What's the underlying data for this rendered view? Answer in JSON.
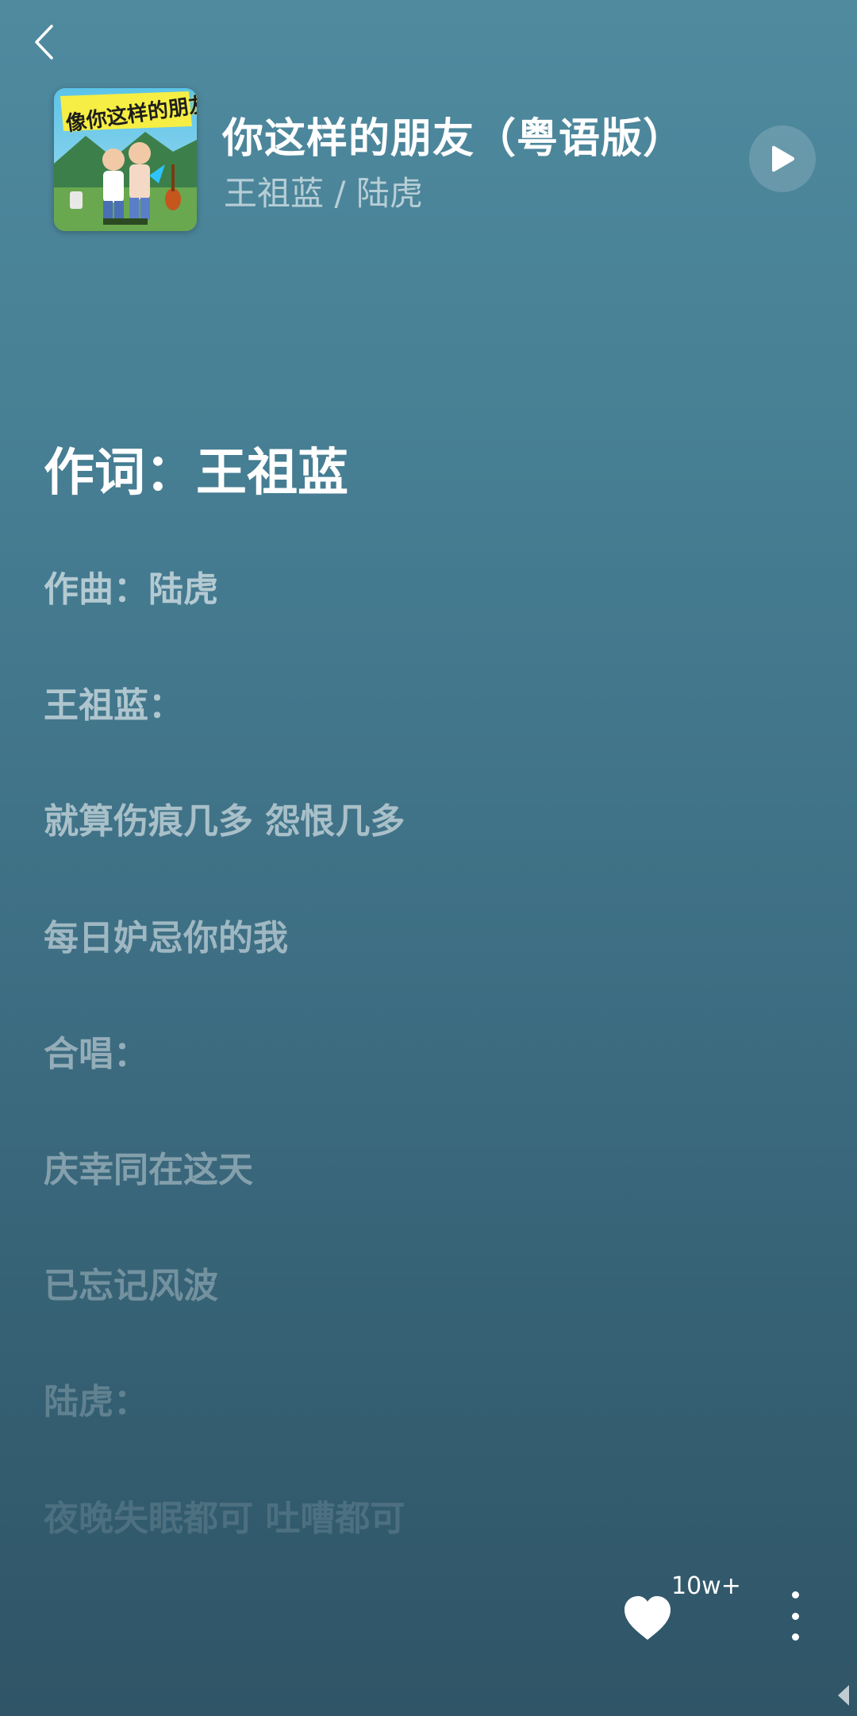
{
  "header": {
    "back_icon": "chevron-left-icon",
    "album_art_text": "像你这样的朋友",
    "title": "你这样的朋友（粤语版）",
    "artists": "王祖蓝 / 陆虎",
    "play_icon": "play-icon"
  },
  "lyrics": [
    {
      "text": "作词：王祖蓝"
    },
    {
      "text": "作曲：陆虎"
    },
    {
      "text": "王祖蓝："
    },
    {
      "text": "就算伤痕几多 怨恨几多"
    },
    {
      "text": "每日妒忌你的我"
    },
    {
      "text": "合唱："
    },
    {
      "text": "庆幸同在这天"
    },
    {
      "text": "已忘记风波"
    },
    {
      "text": "陆虎："
    },
    {
      "text": "夜晚失眠都可 吐嘈都可"
    }
  ],
  "footer": {
    "like_icon": "heart-icon",
    "like_count": "10w+",
    "more_icon": "more-vertical-icon"
  },
  "colors": {
    "bg_top": "#4f8a9f",
    "bg_bottom": "#2f5567",
    "text": "#ffffff"
  }
}
